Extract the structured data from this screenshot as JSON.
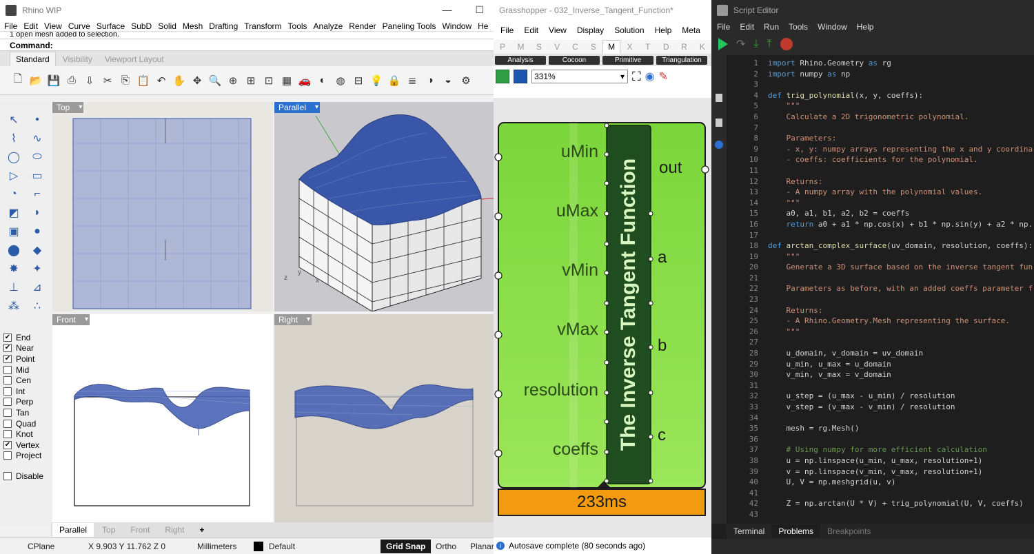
{
  "rhino": {
    "title": "Rhino WIP",
    "menu": [
      "File",
      "Edit",
      "View",
      "Curve",
      "Surface",
      "SubD",
      "Solid",
      "Mesh",
      "Drafting",
      "Transform",
      "Tools",
      "Analyze",
      "Render",
      "Paneling Tools",
      "Window",
      "He"
    ],
    "command_history": "1 open mesh added to selection.",
    "command_label": "Command:",
    "toolbar_tabs": [
      "Standard",
      "Visibility",
      "Viewport Layout"
    ],
    "toolbar_icons": [
      "new-file-icon",
      "open-folder-icon",
      "save-icon",
      "print-icon",
      "import-icon",
      "cut-icon",
      "copy-icon",
      "paste-icon",
      "undo-icon",
      "pan-icon",
      "rotate-view-icon",
      "zoom-icon",
      "zoom-window-icon",
      "zoom-extents-icon",
      "zoom-selected-icon",
      "four-views-icon",
      "car-icon",
      "shaded-icon",
      "render-icon",
      "grid-icon",
      "lightbulb-icon",
      "lock-icon",
      "layers-icon",
      "color-wheel-icon",
      "material-icon",
      "options-icon"
    ],
    "viewports": {
      "top": "Top",
      "parallel": "Parallel",
      "front": "Front",
      "right": "Right"
    },
    "snaps": [
      {
        "label": "End",
        "checked": true
      },
      {
        "label": "Near",
        "checked": true
      },
      {
        "label": "Point",
        "checked": true
      },
      {
        "label": "Mid",
        "checked": false
      },
      {
        "label": "Cen",
        "checked": false
      },
      {
        "label": "Int",
        "checked": false
      },
      {
        "label": "Perp",
        "checked": false
      },
      {
        "label": "Tan",
        "checked": false
      },
      {
        "label": "Quad",
        "checked": false
      },
      {
        "label": "Knot",
        "checked": false
      },
      {
        "label": "Vertex",
        "checked": true
      },
      {
        "label": "Project",
        "checked": false
      }
    ],
    "disable_label": "Disable",
    "viewport_tabs": [
      "Parallel",
      "Top",
      "Front",
      "Right"
    ],
    "add_tab": "+",
    "status": {
      "cplane": "CPlane",
      "coords": "X 9.903 Y 11.762 Z 0",
      "units": "Millimeters",
      "layer": "Default",
      "grid_snap": "Grid Snap",
      "ortho": "Ortho",
      "planar": "Planar"
    },
    "colors": {
      "mesh": "#3a56a8",
      "active_view": "#2b6fd0"
    }
  },
  "grasshopper": {
    "title": "Grasshopper - 032_Inverse_Tangent_Function*",
    "menu": [
      "File",
      "Edit",
      "View",
      "Display",
      "Solution",
      "Help",
      "Meta"
    ],
    "tabs": [
      "P",
      "M",
      "S",
      "V",
      "C",
      "S",
      "M",
      "X",
      "T",
      "D",
      "R",
      "K"
    ],
    "active_tab_index": 6,
    "categories": [
      "Analysis",
      "Cocoon",
      "Primitive",
      "Triangulation"
    ],
    "zoom": "331%",
    "component": {
      "title": "The Inverse Tangent Function",
      "inputs": [
        "uMin",
        "uMax",
        "vMin",
        "vMax",
        "resolution",
        "coeffs"
      ],
      "outputs": [
        "out",
        "a",
        "b",
        "c"
      ],
      "timing": "233ms",
      "colors": {
        "body": "#8fe04a",
        "title": "#1f4d1f",
        "timing": "#f29b11"
      }
    },
    "status": "Autosave complete (80 seconds ago)"
  },
  "script_editor": {
    "title": "Script Editor",
    "menu": [
      "File",
      "Edit",
      "Run",
      "Tools",
      "Window",
      "Help"
    ],
    "code_lines": [
      "import Rhino.Geometry as rg",
      "import numpy as np",
      "",
      "def trig_polynomial(x, y, coeffs):",
      "    \"\"\"",
      "    Calculate a 2D trigonometric polynomial.",
      "",
      "    Parameters:",
      "    - x, y: numpy arrays representing the x and y coordina",
      "    - coeffs: coefficients for the polynomial.",
      "",
      "    Returns:",
      "    - A numpy array with the polynomial values.",
      "    \"\"\"",
      "    a0, a1, b1, a2, b2 = coeffs",
      "    return a0 + a1 * np.cos(x) + b1 * np.sin(y) + a2 * np.",
      "",
      "def arctan_complex_surface(uv_domain, resolution, coeffs):",
      "    \"\"\"",
      "    Generate a 3D surface based on the inverse tangent fun",
      "",
      "    Parameters as before, with an added coeffs parameter f",
      "",
      "    Returns:",
      "    - A Rhino.Geometry.Mesh representing the surface.",
      "    \"\"\"",
      "",
      "    u_domain, v_domain = uv_domain",
      "    u_min, u_max = u_domain",
      "    v_min, v_max = v_domain",
      "",
      "    u_step = (u_max - u_min) / resolution",
      "    v_step = (v_max - v_min) / resolution",
      "",
      "    mesh = rg.Mesh()",
      "",
      "    # Using numpy for more efficient calculation",
      "    u = np.linspace(u_min, u_max, resolution+1)",
      "    v = np.linspace(v_min, v_max, resolution+1)",
      "    U, V = np.meshgrid(u, v)",
      "",
      "    Z = np.arctan(U * V) + trig_polynomial(U, V, coeffs)",
      ""
    ],
    "line_kinds": [
      "kw",
      "kw",
      "",
      "kw",
      "st",
      "st",
      "st",
      "st",
      "st",
      "st",
      "st",
      "st",
      "st",
      "st",
      "",
      "kw",
      "",
      "kw",
      "st",
      "st",
      "st",
      "st",
      "st",
      "st",
      "st",
      "st",
      "",
      "",
      "",
      "",
      "",
      "",
      "",
      "",
      "",
      "",
      "cm",
      "",
      "",
      "",
      "",
      "",
      ""
    ],
    "bottom_tabs": [
      "Terminal",
      "Problems",
      "Breakpoints"
    ],
    "active_bottom_tab": "Problems"
  }
}
